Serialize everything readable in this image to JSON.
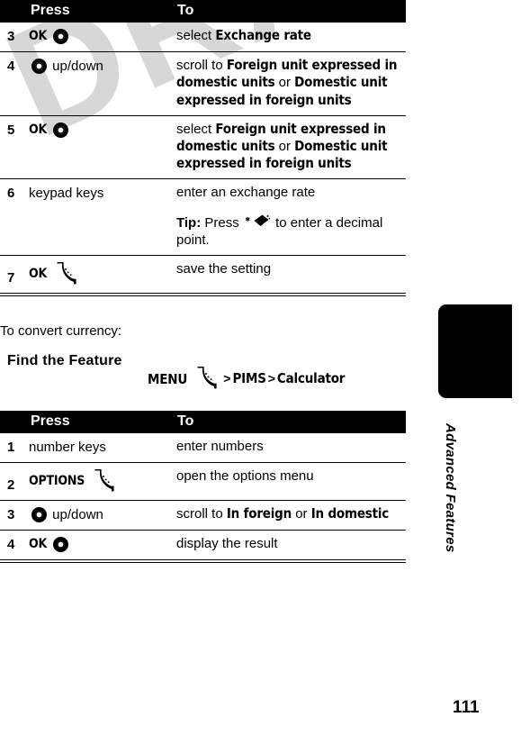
{
  "watermark": {
    "text": "DRAFT"
  },
  "table1": {
    "name": "exchange-rate-procedure-table",
    "headers": {
      "num": "",
      "press": "Press",
      "to": "To"
    },
    "rows": [
      {
        "num": "3",
        "press_text": "OK",
        "press_icon": "nav-key-icon",
        "to_prefix": "select ",
        "to_ui": "Exchange rate",
        "to_suffix": ""
      },
      {
        "num": "4",
        "press_text": "up/down",
        "press_icon": "nav-key-icon",
        "to_prefix": "scroll to ",
        "to_ui": "Foreign unit expressed in domestic units",
        "to_mid": " or ",
        "to_ui2": "Domestic unit expressed in foreign units"
      },
      {
        "num": "5",
        "press_text": "OK",
        "press_icon": "nav-key-icon",
        "to_prefix": "select ",
        "to_ui": "Foreign unit expressed in domestic units",
        "to_mid": " or ",
        "to_ui2": "Domestic unit expressed in foreign units"
      },
      {
        "num": "6",
        "press_text": "keypad keys",
        "press_icon": "",
        "to_prefix": "enter an exchange rate",
        "tip_label": "Tip:",
        "tip_before": " Press ",
        "tip_icon": "star-key-icon",
        "tip_after": " to enter a decimal point."
      },
      {
        "num": "7",
        "press_text": "OK",
        "press_icon": "soft-key-icon",
        "to_prefix": "save the setting",
        "to_ui": ""
      }
    ]
  },
  "intro": {
    "lead": "To convert currency:",
    "find_label": "Find the Feature",
    "path_menu": "MENU",
    "path_icon": "soft-key-icon",
    "path_sep1": ">",
    "path_item1": "PIMS",
    "path_sep2": ">",
    "path_item2": "Calculator"
  },
  "table2": {
    "name": "convert-currency-procedure-table",
    "headers": {
      "num": "",
      "press": "Press",
      "to": "To"
    },
    "rows": [
      {
        "num": "1",
        "press_text": "number keys",
        "press_icon": "",
        "to_prefix": "enter numbers"
      },
      {
        "num": "2",
        "press_text": "OPTIONS",
        "press_icon": "soft-key-icon",
        "to_prefix": "open the options menu"
      },
      {
        "num": "3",
        "press_text": "up/down",
        "press_icon": "nav-key-icon",
        "to_prefix": "scroll to ",
        "to_ui": "In foreign",
        "to_mid": " or ",
        "to_ui2": "In domestic"
      },
      {
        "num": "4",
        "press_text": "OK",
        "press_icon": "nav-key-icon",
        "to_prefix": "display the result"
      }
    ]
  },
  "sidebar": {
    "tab_label": "Advanced Features",
    "page_number": "111"
  },
  "colors": {
    "header_bg": "#000000",
    "header_fg": "#ffffff",
    "rule": "#000000",
    "watermark": "#d7d7d7",
    "page_bg": "#ffffff"
  }
}
